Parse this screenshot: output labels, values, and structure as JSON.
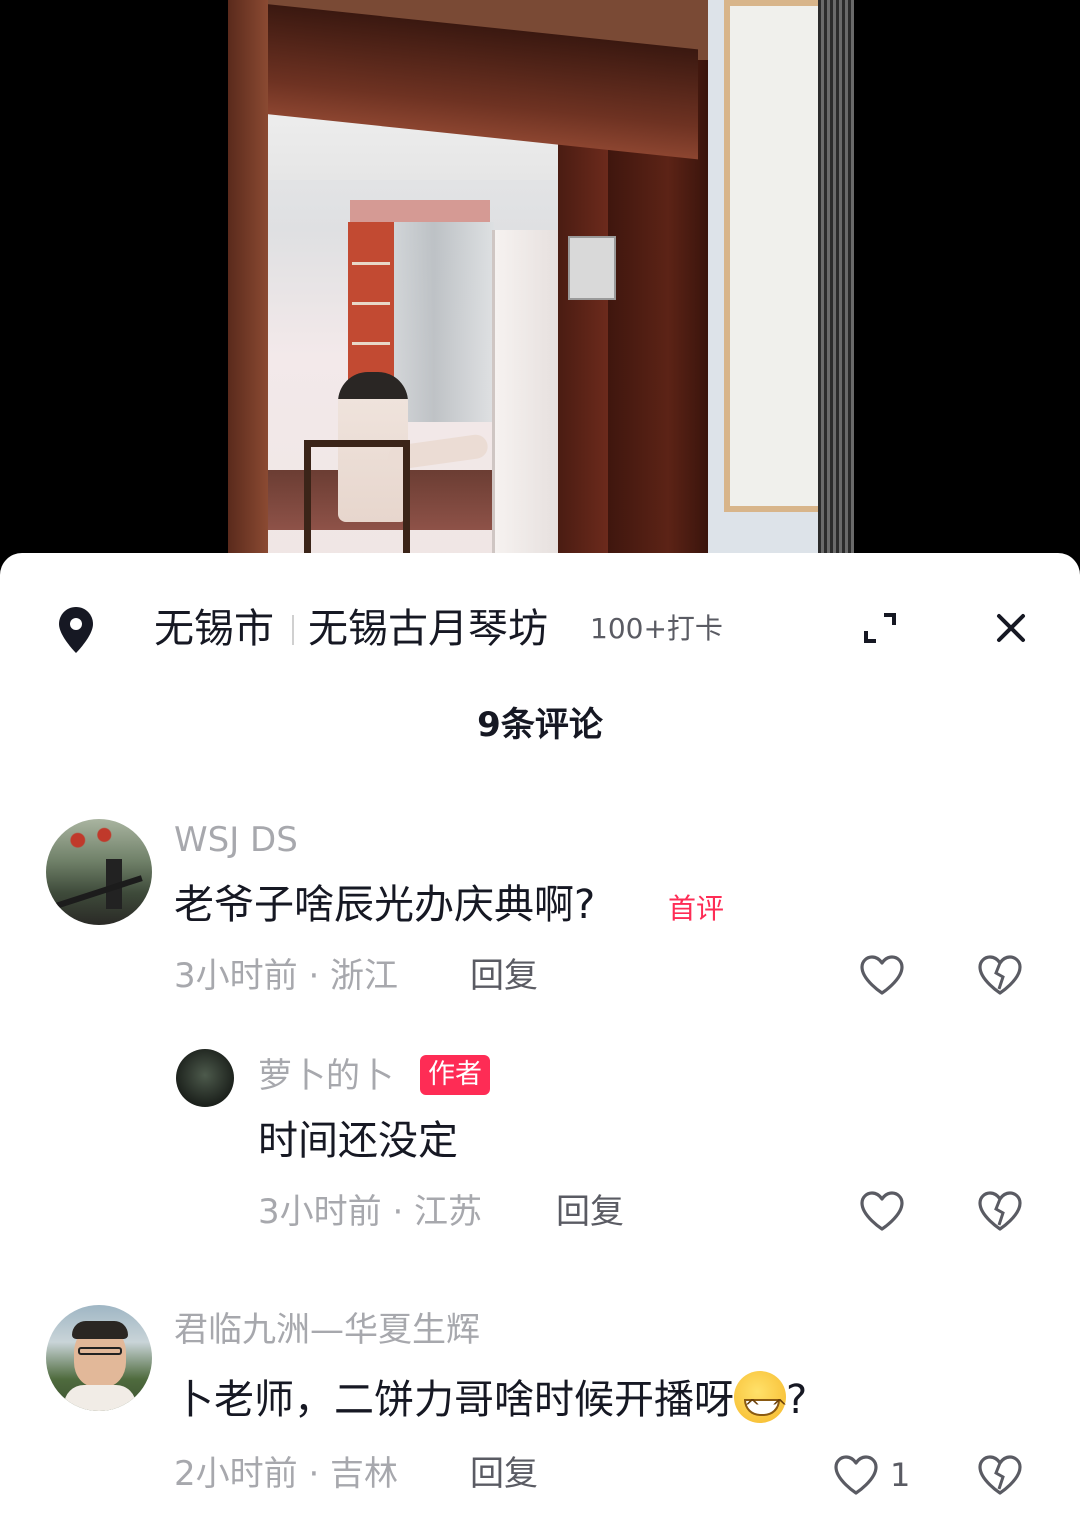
{
  "location": {
    "city": "无锡市",
    "place": "无锡古月琴坊",
    "checkins": "100+打卡"
  },
  "comments_title": "9条评论",
  "reply_label": "回复",
  "comments": [
    {
      "user": "WSJ DS",
      "text": "老爷子啥辰光办庆典啊?",
      "badge": "首评",
      "meta": "3小时前 · 浙江"
    },
    {
      "user": "萝卜的卜",
      "author_badge": "作者",
      "text": "时间还没定",
      "meta": "3小时前 · 江苏"
    },
    {
      "user": "君临九洲—华夏生辉",
      "text": "卜老师，二饼力哥啥时候开播呀",
      "text_suffix": "?",
      "emoji": "grinning-face-emoji",
      "meta": "2小时前 · 吉林",
      "likes": "1"
    }
  ],
  "icons": {
    "location": "location-pin-icon",
    "expand": "expand-icon",
    "close": "close-icon",
    "like": "heart-outline-icon",
    "dislike": "broken-heart-icon"
  },
  "colors": {
    "accent": "#fe2c55",
    "text": "#161823",
    "muted": "#a7a8ad"
  }
}
